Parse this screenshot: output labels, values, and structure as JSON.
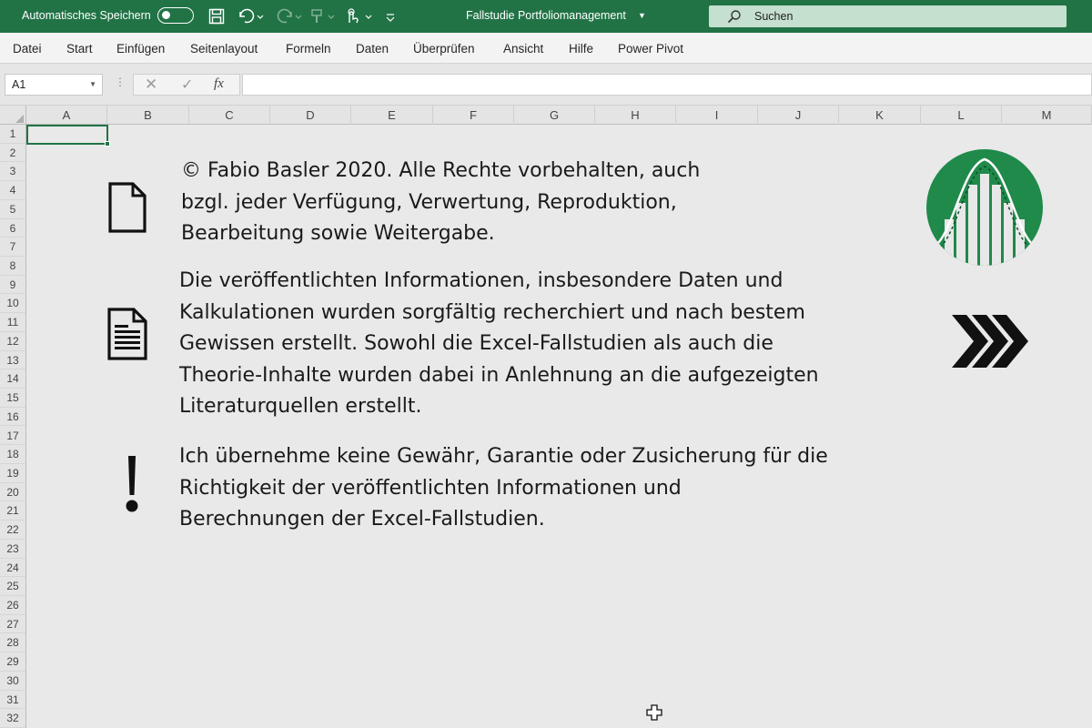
{
  "titlebar": {
    "autosave_label": "Automatisches Speichern",
    "document_title": "Fallstudie Portfoliomanagement",
    "search_placeholder": "Suchen"
  },
  "menu": [
    "Datei",
    "Start",
    "Einfügen",
    "Seitenlayout",
    "Formeln",
    "Daten",
    "Überprüfen",
    "Ansicht",
    "Hilfe",
    "Power Pivot"
  ],
  "formula_bar": {
    "name_box": "A1",
    "fx_label": "fx",
    "formula": ""
  },
  "columns": [
    "A",
    "B",
    "C",
    "D",
    "E",
    "F",
    "G",
    "H",
    "I",
    "J",
    "K",
    "L",
    "M"
  ],
  "rows": [
    "1",
    "2",
    "3",
    "4",
    "5",
    "6",
    "7",
    "8",
    "9",
    "10",
    "11",
    "12",
    "13",
    "14",
    "15",
    "16",
    "17",
    "18",
    "19",
    "20",
    "21",
    "22",
    "23",
    "24",
    "25",
    "26",
    "27",
    "28",
    "29",
    "30",
    "31",
    "32"
  ],
  "content": {
    "copyright": "© Fabio Basler 2020. Alle Rechte vorbehalten, auch\nbzgl. jeder Verfügung, Verwertung, Reproduktion,\nBearbeitung sowie Weitergabe.",
    "info": "Die veröffentlichten Informationen, insbesondere Daten und\nKalkulationen wurden sorgfältig recherchiert und nach bestem\nGewissen erstellt. Sowohl die Excel-Fallstudien als auch die\nTheorie-Inhalte wurden dabei in Anlehnung an die aufgezeigten\nLiteraturquellen erstellt.",
    "disclaimer": "Ich übernehme keine Gewähr, Garantie oder Zusicherung für die\nRichtigkeit der veröffentlichten Informationen und\nBerechnungen der Excel-Fallstudien."
  },
  "icons": {
    "document": "document-icon",
    "text_document": "text-document-icon",
    "exclamation": "exclamation-icon",
    "logo": "bell-curve-logo",
    "next": "chevron-right-triple-icon"
  },
  "colors": {
    "excel_green": "#217346",
    "logo_green": "#1f8a4a"
  }
}
